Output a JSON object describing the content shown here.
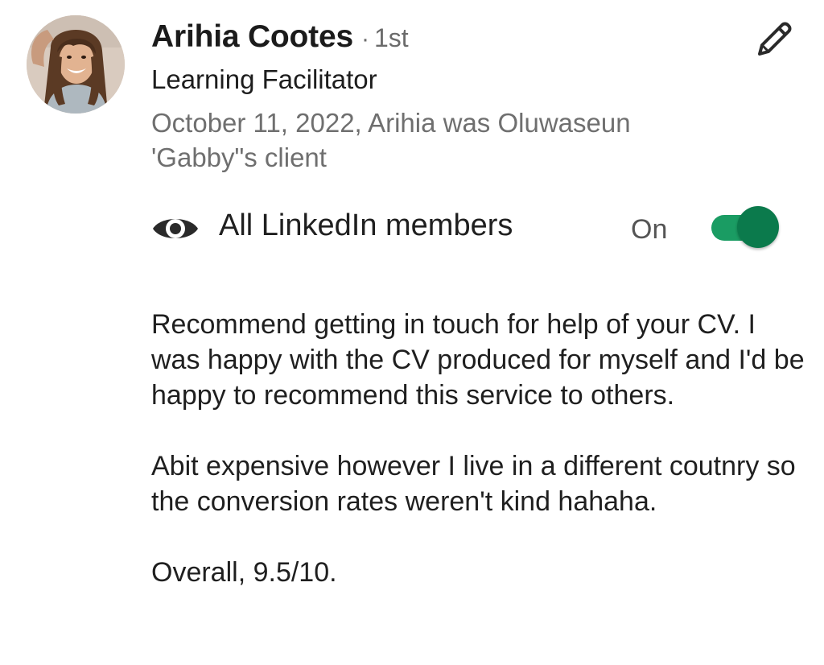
{
  "profile": {
    "name": "Arihia Cootes",
    "separator": "·",
    "degree": "1st",
    "headline": "Learning Facilitator",
    "relationship": "October 11, 2022, Arihia was Oluwaseun 'Gabby\"s client"
  },
  "visibility": {
    "label": "All LinkedIn members",
    "state": "On",
    "enabled": true,
    "accent_color": "#0b7a4c"
  },
  "icons": {
    "edit": "pencil-icon",
    "visibility": "eye-icon"
  },
  "recommendation": {
    "paragraphs": [
      "Recommend getting in touch for help of your CV. I was happy with the CV produced for myself and I'd be happy to recommend this service to others.",
      "Abit expensive however I live in a different coutnry so the conversion rates weren't kind hahaha.",
      "Overall, 9.5/10."
    ]
  }
}
